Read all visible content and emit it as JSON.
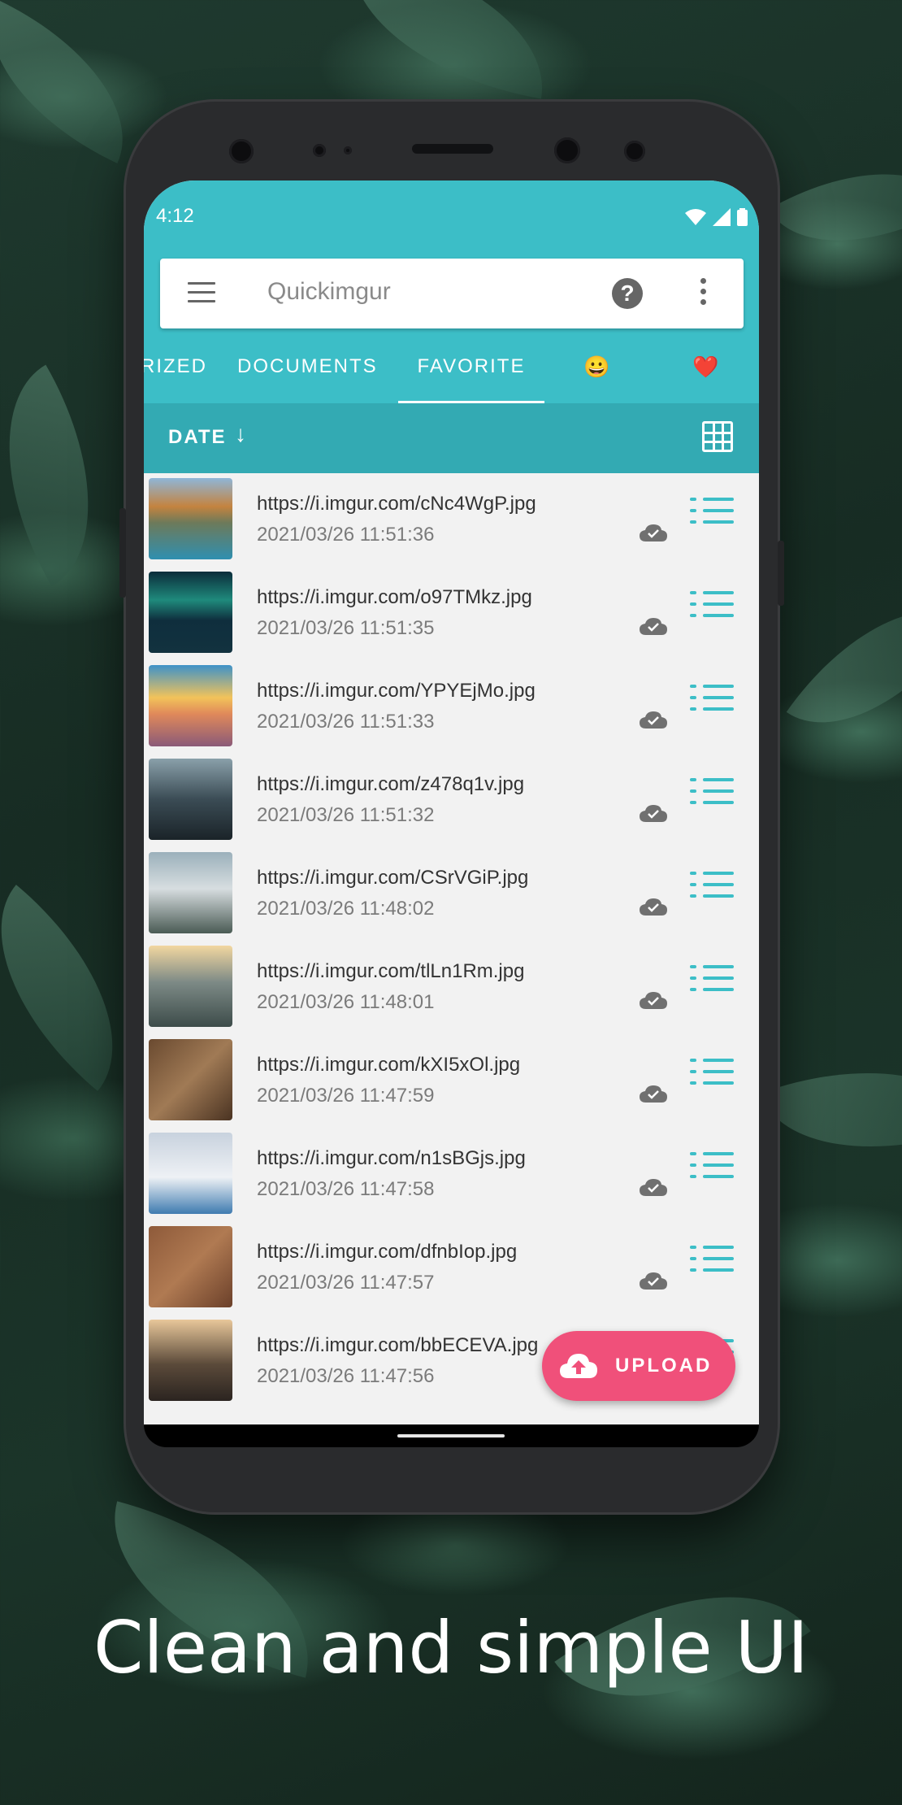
{
  "status_bar": {
    "time": "4:12"
  },
  "app_bar": {
    "title": "Quickimgur"
  },
  "tabs": [
    {
      "label": "RIZED"
    },
    {
      "label": "DOCUMENTS"
    },
    {
      "label": "FAVORITE",
      "active": true
    },
    {
      "label": "😀"
    },
    {
      "label": "❤️"
    }
  ],
  "sort": {
    "label": "DATE",
    "direction_glyph": "↓"
  },
  "images": [
    {
      "url": "https://i.imgur.com/cNc4WgP.jpg",
      "date": "2021/03/26 11:51:36"
    },
    {
      "url": "https://i.imgur.com/o97TMkz.jpg",
      "date": "2021/03/26 11:51:35"
    },
    {
      "url": "https://i.imgur.com/YPYEjMo.jpg",
      "date": "2021/03/26 11:51:33"
    },
    {
      "url": "https://i.imgur.com/z478q1v.jpg",
      "date": "2021/03/26 11:51:32"
    },
    {
      "url": "https://i.imgur.com/CSrVGiP.jpg",
      "date": "2021/03/26 11:48:02"
    },
    {
      "url": "https://i.imgur.com/tlLn1Rm.jpg",
      "date": "2021/03/26 11:48:01"
    },
    {
      "url": "https://i.imgur.com/kXI5xOl.jpg",
      "date": "2021/03/26 11:47:59"
    },
    {
      "url": "https://i.imgur.com/n1sBGjs.jpg",
      "date": "2021/03/26 11:47:58"
    },
    {
      "url": "https://i.imgur.com/dfnbIop.jpg",
      "date": "2021/03/26 11:47:57"
    },
    {
      "url": "https://i.imgur.com/bbECEVA.jpg",
      "date": "2021/03/26 11:47:56"
    }
  ],
  "fab": {
    "label": "UPLOAD"
  },
  "caption": "Clean and simple UI",
  "colors": {
    "primary": "#3cbec7",
    "primary_dark": "#33aab3",
    "accent": "#f0507a"
  },
  "icons": [
    "menu-icon",
    "help-icon",
    "more-vert-icon",
    "grid-icon",
    "cloud-done-icon",
    "list-icon",
    "cloud-upload-icon",
    "wifi-icon",
    "signal-icon",
    "battery-icon"
  ]
}
